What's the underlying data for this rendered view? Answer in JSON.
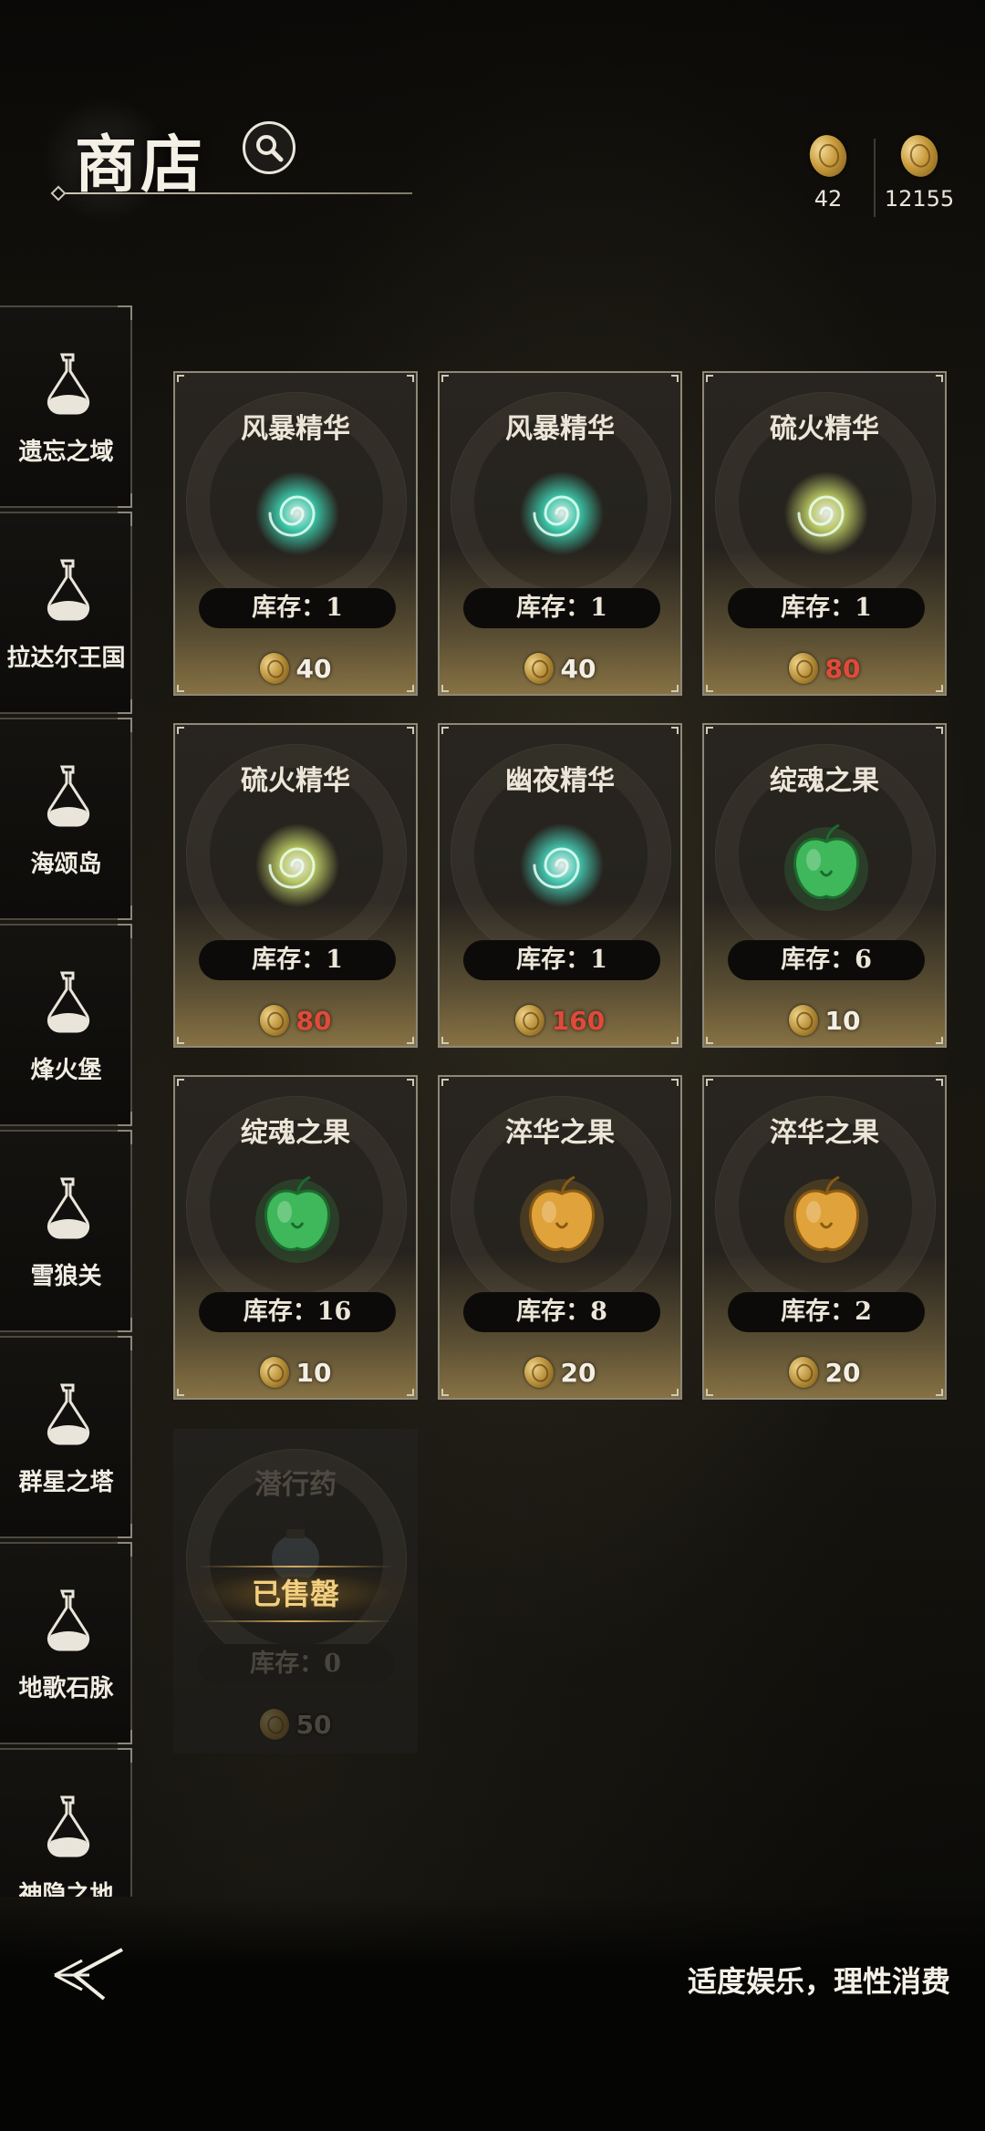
{
  "header": {
    "title": "商店",
    "currencies": [
      {
        "icon": "gold-coin-icon",
        "value": "42"
      },
      {
        "icon": "gold-coin-icon",
        "value": "12155"
      }
    ]
  },
  "sidebar": {
    "items": [
      {
        "label": "遗忘之域",
        "icon": "flask-icon"
      },
      {
        "label": "拉达尔王国",
        "icon": "flask-icon"
      },
      {
        "label": "海颂岛",
        "icon": "flask-icon"
      },
      {
        "label": "烽火堡",
        "icon": "flask-icon"
      },
      {
        "label": "雪狼关",
        "icon": "flask-icon"
      },
      {
        "label": "群星之塔",
        "icon": "flask-icon"
      },
      {
        "label": "地歌石脉",
        "icon": "flask-icon"
      },
      {
        "label": "神隐之地",
        "icon": "flask-icon"
      }
    ]
  },
  "shop": {
    "items": [
      {
        "name": "风暴精华",
        "stock": "库存：1",
        "price": "40",
        "price_affordable": true,
        "icon": "swirl-essence-icon",
        "color": "#3fd9b8"
      },
      {
        "name": "风暴精华",
        "stock": "库存：1",
        "price": "40",
        "price_affordable": true,
        "icon": "swirl-essence-icon",
        "color": "#3fd9b8"
      },
      {
        "name": "硫火精华",
        "stock": "库存：1",
        "price": "80",
        "price_affordable": false,
        "icon": "swirl-essence-icon",
        "color": "#c8d86a"
      },
      {
        "name": "硫火精华",
        "stock": "库存：1",
        "price": "80",
        "price_affordable": false,
        "icon": "swirl-essence-icon",
        "color": "#c8d86a"
      },
      {
        "name": "幽夜精华",
        "stock": "库存：1",
        "price": "160",
        "price_affordable": false,
        "icon": "swirl-essence-icon",
        "color": "#48d8c0"
      },
      {
        "name": "绽魂之果",
        "stock": "库存：6",
        "price": "10",
        "price_affordable": true,
        "icon": "green-apple-icon",
        "color": "#3eb85a"
      },
      {
        "name": "绽魂之果",
        "stock": "库存：16",
        "price": "10",
        "price_affordable": true,
        "icon": "green-apple-icon",
        "color": "#3eb85a"
      },
      {
        "name": "淬华之果",
        "stock": "库存：8",
        "price": "20",
        "price_affordable": true,
        "icon": "golden-apple-icon",
        "color": "#e0a23a"
      },
      {
        "name": "淬华之果",
        "stock": "库存：2",
        "price": "20",
        "price_affordable": true,
        "icon": "golden-apple-icon",
        "color": "#e0a23a"
      }
    ],
    "sold_item": {
      "name": "潜行药",
      "stock": "库存：0",
      "price": "50",
      "sold_label": "已售罄",
      "icon": "potion-icon"
    }
  },
  "footer": {
    "back_icon": "back-arrow-icon",
    "slogan": "适度娱乐，理性消费"
  },
  "colors": {
    "price_red": "#e04a3a",
    "sold_gold": "#f3cf7e"
  }
}
